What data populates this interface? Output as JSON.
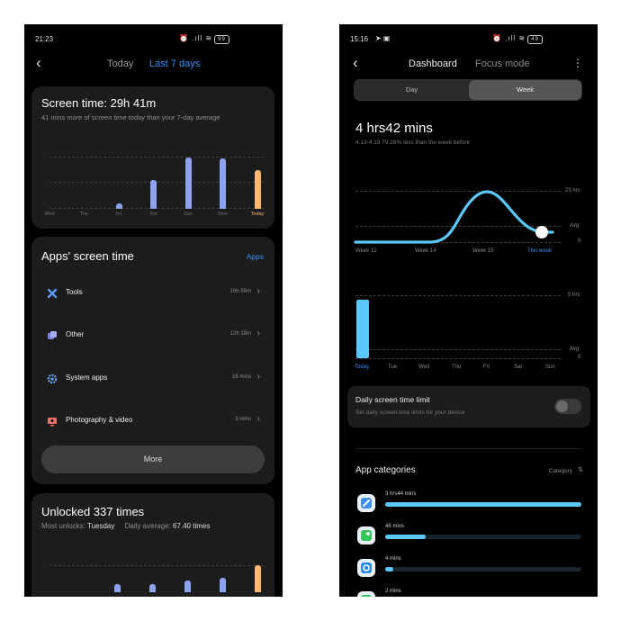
{
  "left": {
    "status": {
      "time": "21:23",
      "icons": "⏰ .ıll ≋",
      "battery": "99"
    },
    "tabs": {
      "today": "Today",
      "last7": "Last 7 days"
    },
    "screen_time": {
      "title": "Screen time: 29h 41m",
      "subtitle": "41 mins more of screen time today than your 7-day average",
      "days": [
        "Wed",
        "Thu",
        "Fri",
        "Sat",
        "Sun",
        "Mon",
        "Today"
      ]
    },
    "apps": {
      "title": "Apps' screen time",
      "link": "Apps",
      "items": [
        {
          "name": "Tools",
          "time": "16h 59m"
        },
        {
          "name": "Other",
          "time": "12h 18m"
        },
        {
          "name": "System apps",
          "time": "16 mins"
        },
        {
          "name": "Photography & video",
          "time": "3 mins"
        }
      ],
      "more": "More"
    },
    "unlocked": {
      "title": "Unlocked 337 times",
      "most_label": "Most unlocks:",
      "most_value": "Tuesday",
      "avg_label": "Daily average:",
      "avg_value": "67.40 times"
    }
  },
  "right": {
    "status": {
      "time": "15:16",
      "icons": "⏰ .ıll ≋",
      "battery": "49"
    },
    "tabs": {
      "dashboard": "Dashboard",
      "focus": "Focus mode"
    },
    "segment": {
      "day": "Day",
      "week": "Week"
    },
    "total": "4 hrs42 mins",
    "compare": "4.13-4.19  79.28% less than the week before",
    "trend": {
      "y_max": "23 hrs",
      "y_avg": "Avg",
      "y_zero": "0",
      "weeks": [
        "Week 12",
        "Week 14",
        "Week 15",
        "This week"
      ]
    },
    "daily": {
      "y_max": "5 hrs",
      "y_avg": "Avg",
      "y_zero": "0",
      "days": [
        "Today",
        "Tue",
        "Wed",
        "Thu",
        "Fri",
        "Sat",
        "Sun"
      ]
    },
    "limit": {
      "title": "Daily screen time limit",
      "subtitle": "Set daily screen time limits for your device"
    },
    "categories": {
      "title": "App categories",
      "sort": "Category",
      "items": [
        {
          "value": "3 hrs44 mins"
        },
        {
          "value": "46 mins"
        },
        {
          "value": "4 mins"
        },
        {
          "value": "2 mins"
        }
      ]
    }
  },
  "colors": {
    "accent_blue": "#3b8ff5",
    "bar_blue": "#8ea3f0",
    "bar_orange": "#ffb870",
    "chart_cyan": "#5ac8fa"
  },
  "chart_data": [
    {
      "type": "bar",
      "title": "Screen time: 29h 41m",
      "categories": [
        "Wed",
        "Thu",
        "Fri",
        "Sat",
        "Sun",
        "Mon",
        "Today"
      ],
      "values": [
        0,
        0,
        0.1,
        0.56,
        1.0,
        0.98,
        0.76
      ]
    },
    {
      "type": "line",
      "categories": [
        "Week 12",
        "Week 14",
        "Week 15",
        "This week"
      ],
      "ylim": [
        0,
        23
      ],
      "values": [
        0,
        0,
        23,
        4.7
      ]
    },
    {
      "type": "bar",
      "categories": [
        "Today",
        "Tue",
        "Wed",
        "Thu",
        "Fri",
        "Sat",
        "Sun"
      ],
      "ylim": [
        0,
        5
      ],
      "values": [
        4.7,
        0,
        0,
        0,
        0,
        0,
        0
      ]
    },
    {
      "type": "bar",
      "title": "App categories",
      "categories": [
        "3 hrs44 mins",
        "46 mins",
        "4 mins",
        "2 mins"
      ],
      "values": [
        224,
        46,
        4,
        2
      ]
    }
  ]
}
